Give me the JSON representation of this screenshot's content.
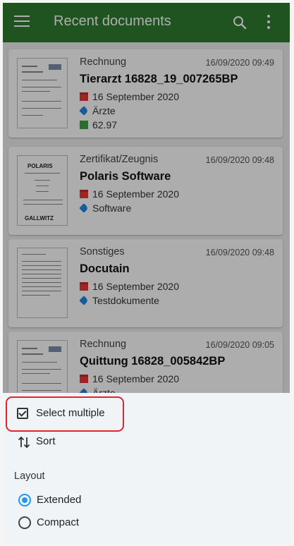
{
  "appbar": {
    "title": "Recent documents",
    "menu_icon": "menu-icon",
    "search_icon": "search-icon",
    "more_icon": "more-vert-icon"
  },
  "documents": [
    {
      "category": "Rechnung",
      "datetime": "16/09/2020 09:49",
      "name": "Tierarzt 16828_19_007265BP",
      "date": "16 September 2020",
      "tag": "Ärzte",
      "amount": "62.97"
    },
    {
      "category": "Zertifikat/Zeugnis",
      "datetime": "16/09/2020 09:48",
      "name": "Polaris Software",
      "date": "16 September 2020",
      "tag": "Software",
      "thumb_top": "POLARIS",
      "thumb_bottom": "GALLWITZ"
    },
    {
      "category": "Sonstiges",
      "datetime": "16/09/2020 09:48",
      "name": "Docutain",
      "date": "16 September 2020",
      "tag": "Testdokumente"
    },
    {
      "category": "Rechnung",
      "datetime": "16/09/2020 09:05",
      "name": "Quittung 16828_005842BP",
      "date": "16 September 2020",
      "tag": "Ärzte"
    }
  ],
  "sheet": {
    "select_multiple": "Select multiple",
    "sort": "Sort",
    "layout_title": "Layout",
    "layout_options": [
      {
        "label": "Extended",
        "selected": true
      },
      {
        "label": "Compact",
        "selected": false
      }
    ]
  },
  "colors": {
    "appbar": "#2e7d32",
    "highlight": "#e0262d",
    "radio_accent": "#2196f3",
    "sheet_bg": "#f0f4f7"
  }
}
